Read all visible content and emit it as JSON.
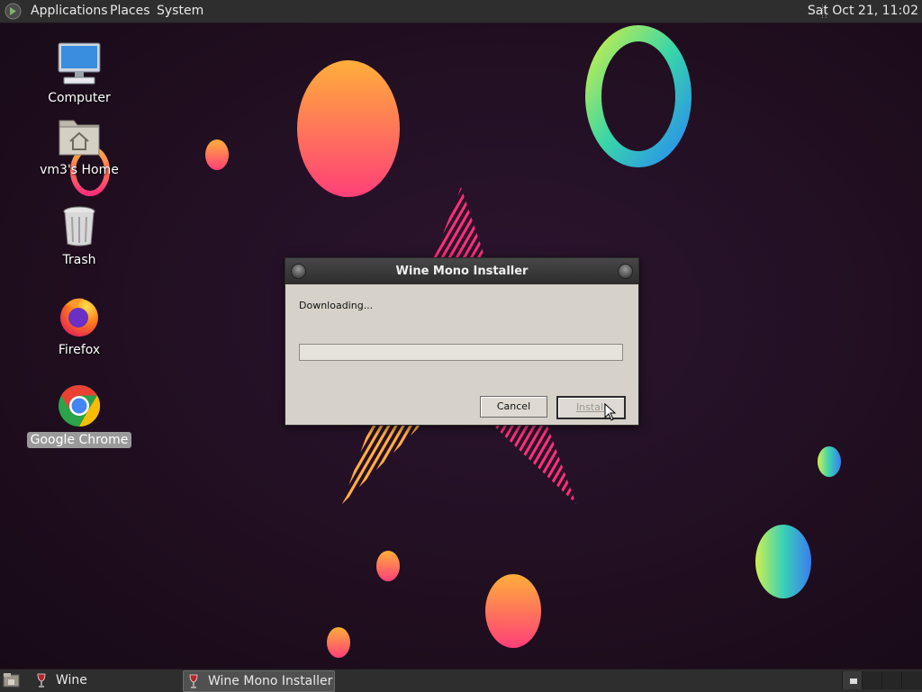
{
  "top_panel": {
    "menus": [
      "Applications",
      "Places",
      "System"
    ],
    "clock": "Sat Oct 21, 11:02"
  },
  "desktop_icons": [
    {
      "label": "Computer",
      "icon": "computer-icon"
    },
    {
      "label": "vm3's Home",
      "icon": "home-folder-icon"
    },
    {
      "label": "Trash",
      "icon": "trash-icon"
    },
    {
      "label": "Firefox",
      "icon": "firefox-icon"
    },
    {
      "label": "Google Chrome",
      "icon": "chrome-icon",
      "selected": true
    }
  ],
  "dialog": {
    "title": "Wine Mono Installer",
    "status": "Downloading...",
    "progress": 0,
    "cancel_label": "Cancel",
    "install_label": "Install"
  },
  "taskbar": {
    "items": [
      {
        "label": "Wine",
        "icon": "wine-glass-icon"
      },
      {
        "label": "Wine Mono Installer",
        "icon": "wine-glass-icon",
        "active": true
      }
    ]
  },
  "colors": {
    "panel": "#2e2e2e",
    "dialog_bg": "#d6d2ca",
    "wallpaper": "#22101f"
  }
}
